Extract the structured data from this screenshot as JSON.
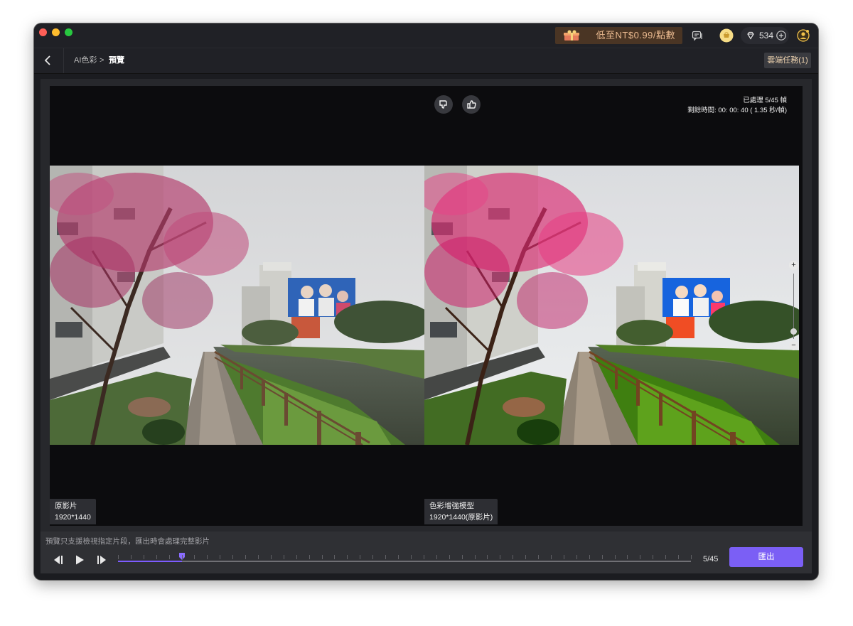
{
  "promo": {
    "text": "低至NT$0.99/點數"
  },
  "account": {
    "points": "534"
  },
  "nav": {
    "breadcrumb_parent": "AI色彩",
    "breadcrumb_separator": ">",
    "breadcrumb_current": "預覽",
    "cloud_tasks": "雲端任務(1)"
  },
  "preview": {
    "processed": "已處理 5/45 幀",
    "remaining": "剩餘時間: 00: 00: 40 ( 1.35 秒/幀)",
    "left": {
      "title": "原影片",
      "resolution": "1920*1440"
    },
    "right": {
      "title": "色彩增強模型",
      "resolution": "1920*1440(原影片)"
    }
  },
  "zoom": {
    "plus": "+",
    "minus": "−"
  },
  "footer": {
    "hint": "預覽只支援檢視指定片段，匯出時會處理完整影片",
    "frame_counter": "5/45",
    "export_label": "匯出"
  },
  "timeline": {
    "current_frame": 5,
    "total_frames": 45
  },
  "colors": {
    "accent": "#7b5ff5",
    "promo_text": "#e9b98f",
    "background": "#1b1c20"
  }
}
